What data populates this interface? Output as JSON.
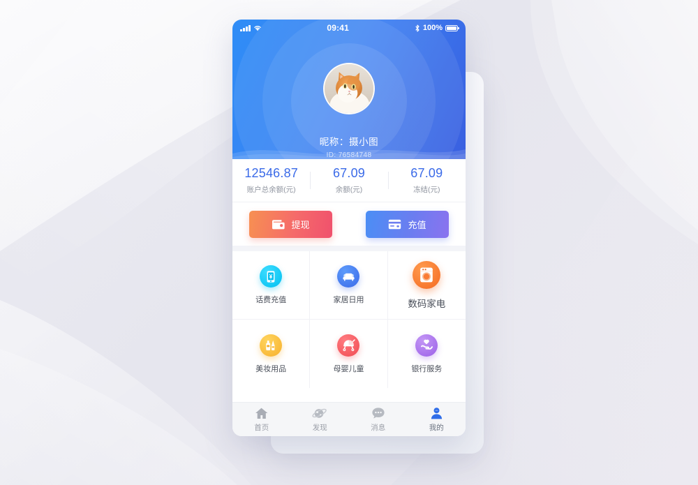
{
  "theme": {
    "brand_blue": "#3a6ae8",
    "header_gradient_from": "#2f8df6",
    "header_gradient_to": "#3a5fe0",
    "withdraw_gradient": "#f79052 → #f0516d",
    "recharge_gradient": "#4b8ef5 → #8a73ef",
    "page_background": "#e8e8ef"
  },
  "statusbar": {
    "signal_icon": "signal-bars-icon",
    "wifi_icon": "wifi-icon",
    "time": "09:41",
    "bluetooth_icon": "bluetooth-icon",
    "battery_percent": "100%",
    "battery_icon": "battery-full-icon"
  },
  "profile": {
    "avatar_icon": "cat-avatar",
    "nickname": "昵称：摄小图",
    "user_id": "ID: 76584748"
  },
  "balances": [
    {
      "value": "12546.87",
      "label": "账户总余额(元)",
      "name": "total-balance"
    },
    {
      "value": "67.09",
      "label": "余额(元)",
      "name": "available-balance"
    },
    {
      "value": "67.09",
      "label": "冻结(元)",
      "name": "frozen-balance"
    }
  ],
  "actions": {
    "withdraw": {
      "label": "提现",
      "icon": "wallet-icon"
    },
    "recharge": {
      "label": "充值",
      "icon": "credit-card-icon"
    }
  },
  "grid": [
    {
      "label": "话费充值",
      "icon": "mobile-topup-icon",
      "color": "#00bff0"
    },
    {
      "label": "家居日用",
      "icon": "sofa-icon",
      "color": "#3a6ae8"
    },
    {
      "label": "数码家电",
      "icon": "washing-machine-icon",
      "color": "#f46a22"
    },
    {
      "label": "美妆用品",
      "icon": "cosmetics-icon",
      "color": "#f7b02c"
    },
    {
      "label": "母婴儿童",
      "icon": "stroller-icon",
      "color": "#f04b52"
    },
    {
      "label": "银行服务",
      "icon": "hand-heart-icon",
      "color": "#9b5fe8"
    }
  ],
  "tabbar": [
    {
      "label": "首页",
      "icon": "home-icon",
      "active": false
    },
    {
      "label": "发现",
      "icon": "planet-icon",
      "active": false
    },
    {
      "label": "消息",
      "icon": "chat-bubble-icon",
      "active": false
    },
    {
      "label": "我的",
      "icon": "person-icon",
      "active": true
    }
  ]
}
